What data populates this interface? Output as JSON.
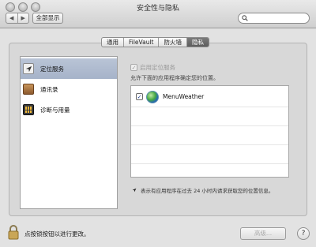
{
  "window": {
    "title": "安全性与隐私"
  },
  "toolbar": {
    "back_glyph": "◀",
    "forward_glyph": "▶",
    "show_all_label": "全部显示",
    "search_placeholder": ""
  },
  "tabs": [
    {
      "label": "通用",
      "active": false
    },
    {
      "label": "FileVault",
      "active": false
    },
    {
      "label": "防火墙",
      "active": false
    },
    {
      "label": "隐私",
      "active": true
    }
  ],
  "sidebar": {
    "items": [
      {
        "label": "定位服务",
        "icon": "location-arrow-icon",
        "selected": true
      },
      {
        "label": "通讯录",
        "icon": "contacts-book-icon",
        "selected": false
      },
      {
        "label": "诊断与用量",
        "icon": "diagnostics-icon",
        "selected": false
      }
    ]
  },
  "location": {
    "enable_label": "启用定位服务",
    "enable_check_glyph": "✓",
    "description": "允许下面的应用程序确定您的位置。",
    "apps": [
      {
        "name": "MenuWeather",
        "checked": true,
        "check_glyph": "✓",
        "icon": "globe-icon"
      }
    ],
    "note": "表示有应用程序在过去 24 小时内请求获取您的位置信息。"
  },
  "footer": {
    "lock_text": "点按锁按钮以进行更改。",
    "advanced_label": "高级...",
    "help_label": "?"
  },
  "colors": {
    "selected_row": "#aeb9cd",
    "active_tab": "#6b6b6b",
    "checkmark": "#1d3d8f"
  }
}
